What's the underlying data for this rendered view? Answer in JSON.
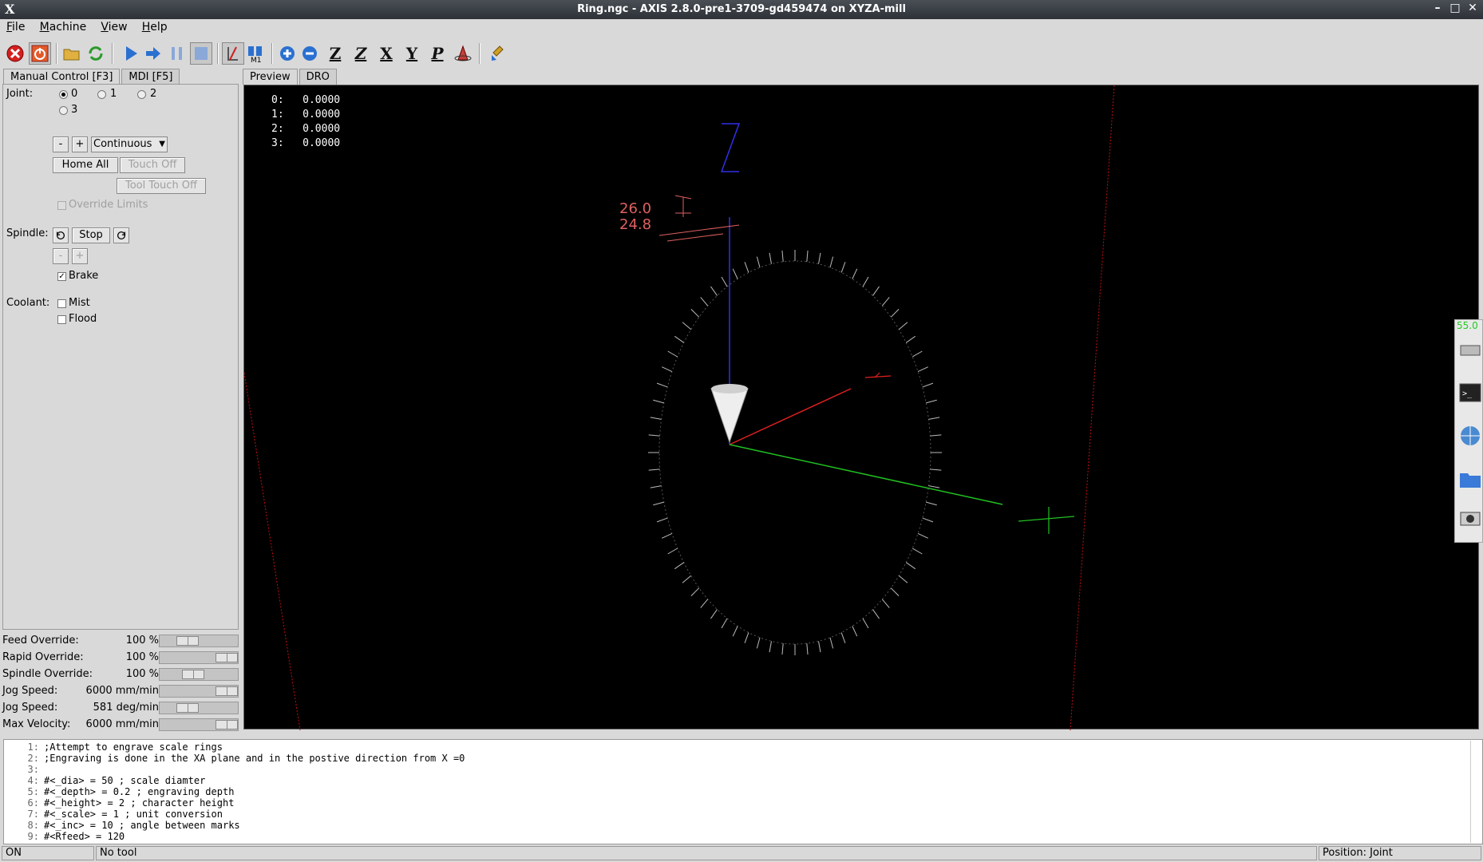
{
  "window": {
    "title": "Ring.ngc - AXIS 2.8.0-pre1-3709-gd459474 on XYZA-mill",
    "logo": "X"
  },
  "menu": [
    "File",
    "Machine",
    "View",
    "Help"
  ],
  "toolbar_icons": [
    "estop-icon",
    "power-icon",
    "open-file-icon",
    "reload-icon",
    "run-icon",
    "step-icon",
    "pause-icon",
    "stop-icon",
    "block-delete-icon",
    "optional-stop-icon",
    "zoom-in-icon",
    "zoom-out-icon",
    "view-z-icon",
    "view-z2-icon",
    "view-x-icon",
    "view-y-icon",
    "view-p-icon",
    "rotate-icon",
    "clear-plot-icon"
  ],
  "toolbar_letters": {
    "z": "Z",
    "z2": "Z",
    "x": "X",
    "y": "Y",
    "p": "P"
  },
  "left_tabs": {
    "manual": "Manual Control [F3]",
    "mdi": "MDI [F5]"
  },
  "manual": {
    "joint_label": "Joint:",
    "joints": [
      "0",
      "1",
      "2",
      "3"
    ],
    "minus": "-",
    "plus": "+",
    "jog_mode": "Continuous",
    "home_all": "Home All",
    "touch_off": "Touch Off",
    "tool_touch_off": "Tool Touch Off",
    "override_limits": "Override Limits",
    "spindle_label": "Spindle:",
    "spindle_stop": "Stop",
    "brake": "Brake",
    "coolant_label": "Coolant:",
    "mist": "Mist",
    "flood": "Flood"
  },
  "overrides": [
    {
      "name": "Feed Override:",
      "value": "100 %",
      "level": 0.3
    },
    {
      "name": "Rapid Override:",
      "value": "100 %",
      "level": 1.0
    },
    {
      "name": "Spindle Override:",
      "value": "100 %",
      "level": 0.4
    },
    {
      "name": "Jog Speed:",
      "value": "6000 mm/min",
      "level": 1.0
    },
    {
      "name": "Jog Speed:",
      "value": "581 deg/min",
      "level": 0.3
    },
    {
      "name": "Max Velocity:",
      "value": "6000 mm/min",
      "level": 1.0
    }
  ],
  "right_tabs": {
    "preview": "Preview",
    "dro": "DRO"
  },
  "dro": [
    {
      "axis": "0:",
      "value": "0.0000"
    },
    {
      "axis": "1:",
      "value": "0.0000"
    },
    {
      "axis": "2:",
      "value": "0.0000"
    },
    {
      "axis": "3:",
      "value": "0.0000"
    }
  ],
  "preview_labels": {
    "z_axis": "Z",
    "dim1": "26.0",
    "dim2": "24.8"
  },
  "code_lines": [
    {
      "n": "1:",
      "t": ";Attempt to engrave scale rings"
    },
    {
      "n": "2:",
      "t": ";Engraving is done in the XA plane and in the postive direction from X =0"
    },
    {
      "n": "3:",
      "t": ""
    },
    {
      "n": "4:",
      "t": "#<_dia> = 50 ; scale diamter"
    },
    {
      "n": "5:",
      "t": "#<_depth> = 0.2 ; engraving depth"
    },
    {
      "n": "6:",
      "t": "#<_height> = 2 ; character height"
    },
    {
      "n": "7:",
      "t": "#<_scale> = 1 ; unit conversion"
    },
    {
      "n": "8:",
      "t": "#<_inc> = 10 ; angle between marks"
    },
    {
      "n": "9:",
      "t": "#<Rfeed> = 120"
    }
  ],
  "status": {
    "state": "ON",
    "tool": "No tool",
    "position": "Position: Joint"
  },
  "dock": {
    "percent": "55.0"
  },
  "colors": {
    "background": "#d9d9d9",
    "preview_bg": "#000000",
    "x_axis": "#e02020",
    "y_axis": "#20c020",
    "z_axis": "#2a2ae0"
  }
}
